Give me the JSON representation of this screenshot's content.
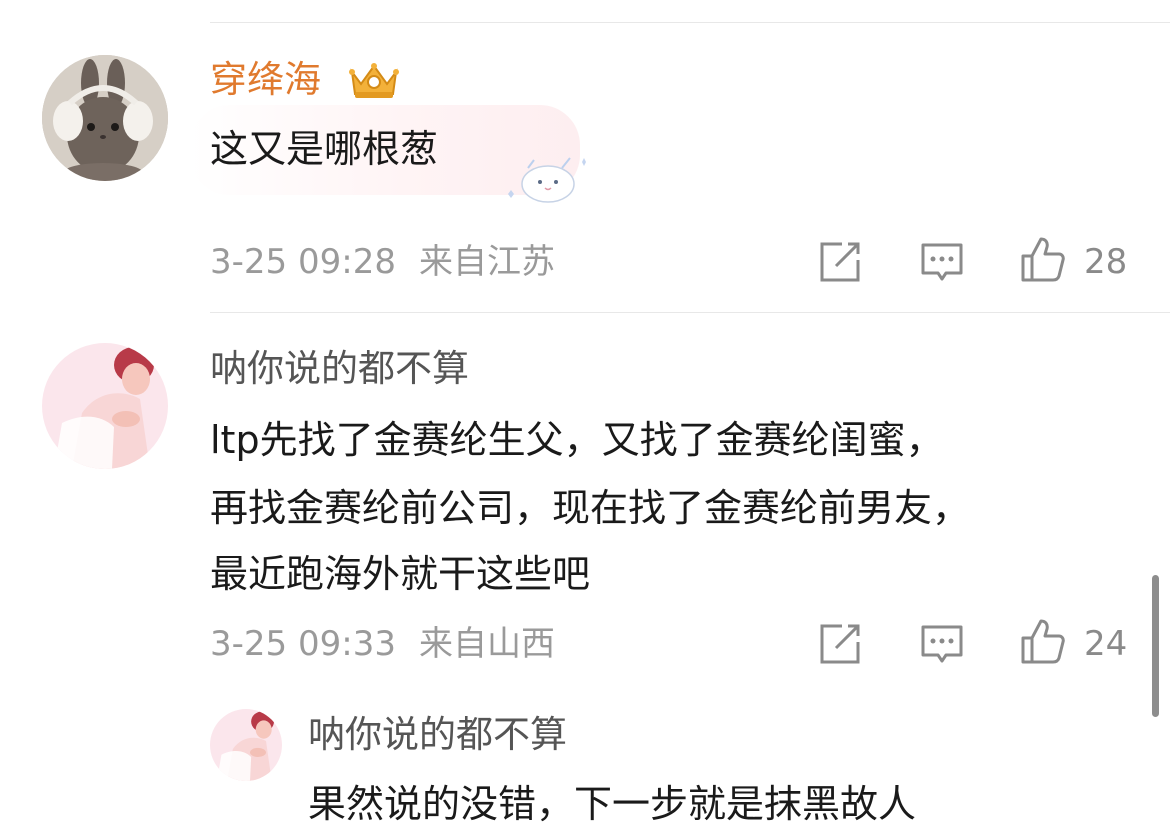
{
  "comments": [
    {
      "username": "穿绛海",
      "username_color": "#e07a2e",
      "badge": "crown-badge-icon",
      "text": "这又是哪根葱",
      "time": "3-25 09:28",
      "location": "来自江苏",
      "likes": "28"
    },
    {
      "username": "呐你说的都不算",
      "username_color": "#555555",
      "lines": [
        "ltp先找了金赛纶生父，又找了金赛纶闺蜜，",
        "再找金赛纶前公司，现在找了金赛纶前男友，",
        "最近跑海外就干这些吧"
      ],
      "time": "3-25 09:33",
      "location": "来自山西",
      "likes": "24"
    }
  ],
  "reply": {
    "username": "呐你说的都不算",
    "text": "果然说的没错，下一步就是抹黑故人"
  },
  "icons": {
    "share": "share-edit-icon",
    "comment": "comment-bubble-icon",
    "like": "thumbs-up-icon"
  }
}
